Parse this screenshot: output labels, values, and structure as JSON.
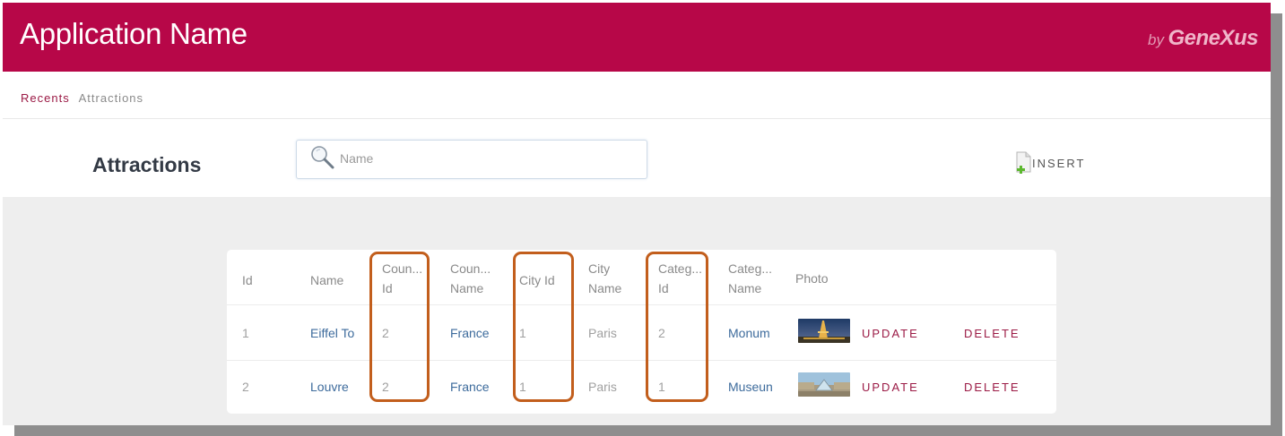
{
  "header": {
    "app_title": "Application Name",
    "brand_by": "by",
    "brand_name": "GeneXus",
    "color": "#b70748"
  },
  "breadcrumb": {
    "items": [
      {
        "label": "Recents",
        "active": true
      },
      {
        "label": "Attractions",
        "active": false
      }
    ]
  },
  "page": {
    "title": "Attractions",
    "search": {
      "placeholder": "Name",
      "value": "",
      "icon": "search-icon"
    },
    "insert": {
      "label": "INSERT",
      "icon": "insert-document-icon"
    }
  },
  "grid": {
    "columns": [
      {
        "key": "id",
        "label": "Id",
        "label2": ""
      },
      {
        "key": "name",
        "label": "Name",
        "label2": ""
      },
      {
        "key": "country_id",
        "label": "Coun...",
        "label2": "Id"
      },
      {
        "key": "country_name",
        "label": "Coun...",
        "label2": "Name"
      },
      {
        "key": "city_id",
        "label": "City Id",
        "label2": ""
      },
      {
        "key": "city_name",
        "label": "City",
        "label2": "Name"
      },
      {
        "key": "category_id",
        "label": "Categ...",
        "label2": "Id"
      },
      {
        "key": "category_name",
        "label": "Categ...",
        "label2": "Name"
      },
      {
        "key": "photo",
        "label": "Photo",
        "label2": ""
      }
    ],
    "rows": [
      {
        "id": "1",
        "name": "Eiffel To",
        "country_id": "2",
        "country_name": "France",
        "city_id": "1",
        "city_name": "Paris",
        "category_id": "2",
        "category_name": "Monum",
        "photo": "eiffel-tower-photo",
        "update": "UPDATE",
        "delete": "DELETE"
      },
      {
        "id": "2",
        "name": "Louvre",
        "country_id": "2",
        "country_name": "France",
        "city_id": "1",
        "city_name": "Paris",
        "category_id": "1",
        "category_name": "Museun",
        "photo": "louvre-photo",
        "update": "UPDATE",
        "delete": "DELETE"
      }
    ]
  },
  "highlights": {
    "color": "#c25e1c",
    "columns": [
      "country_id",
      "city_id",
      "category_id"
    ]
  }
}
